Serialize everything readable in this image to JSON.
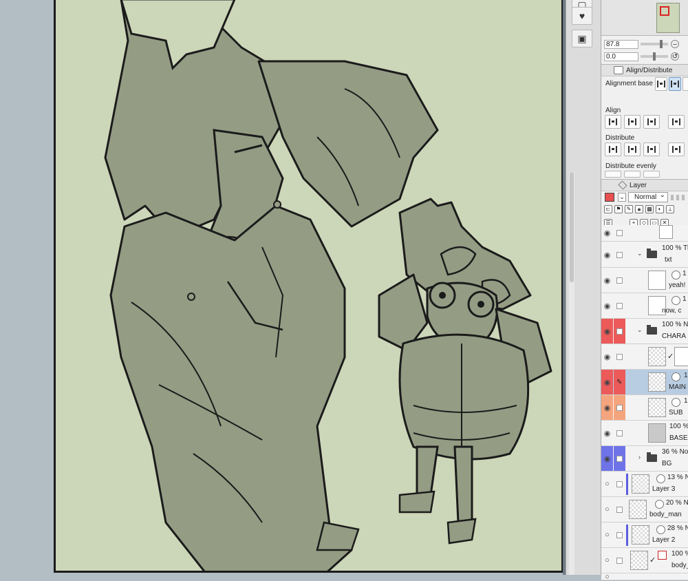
{
  "navigator": {
    "zoom_value": "87.8",
    "rotate_value": "0.0"
  },
  "align_panel": {
    "tab_title": "Align/Distribute",
    "alignment_base_label": "Alignment base",
    "align_label": "Align",
    "distribute_label": "Distribute",
    "distribute_evenly_label": "Distribute evenly"
  },
  "layer_panel": {
    "tab_title": "Layer",
    "blend_mode": "Normal",
    "color": "#e85050",
    "layers": [
      {
        "top": "",
        "name": "",
        "kind": "layer"
      },
      {
        "top": "100 % Th",
        "name": "txt",
        "kind": "folder"
      },
      {
        "top": "1",
        "name": "yeah!",
        "kind": "layer"
      },
      {
        "top": "1",
        "name": "now, c",
        "kind": "layer"
      },
      {
        "top": "100 % No",
        "name": "CHARA",
        "kind": "folder"
      },
      {
        "top": "",
        "name": "",
        "kind": "layer"
      },
      {
        "top": "1",
        "name": "MAIN",
        "kind": "layer"
      },
      {
        "top": "1",
        "name": "SUB",
        "kind": "layer"
      },
      {
        "top": "100 %",
        "name": "BASE",
        "kind": "layer"
      },
      {
        "top": "36 % Nor",
        "name": "BG",
        "kind": "folder"
      },
      {
        "top": "13 % N",
        "name": "Layer 3",
        "kind": "layer"
      },
      {
        "top": "20 % No",
        "name": "body_man",
        "kind": "layer"
      },
      {
        "top": "28 % N",
        "name": "Layer 2",
        "kind": "layer"
      },
      {
        "top": "100 %",
        "name": "body_",
        "kind": "layer"
      }
    ]
  },
  "colors": {
    "canvas_bg": "#ccd6b8",
    "figure_fill": "#949c84",
    "workspace_bg": "#b2bdc4",
    "label_red": "#ec5a5a",
    "label_orange": "#f5a57e",
    "label_blue": "#6f73e8",
    "selected_row": "#b9cde2"
  }
}
